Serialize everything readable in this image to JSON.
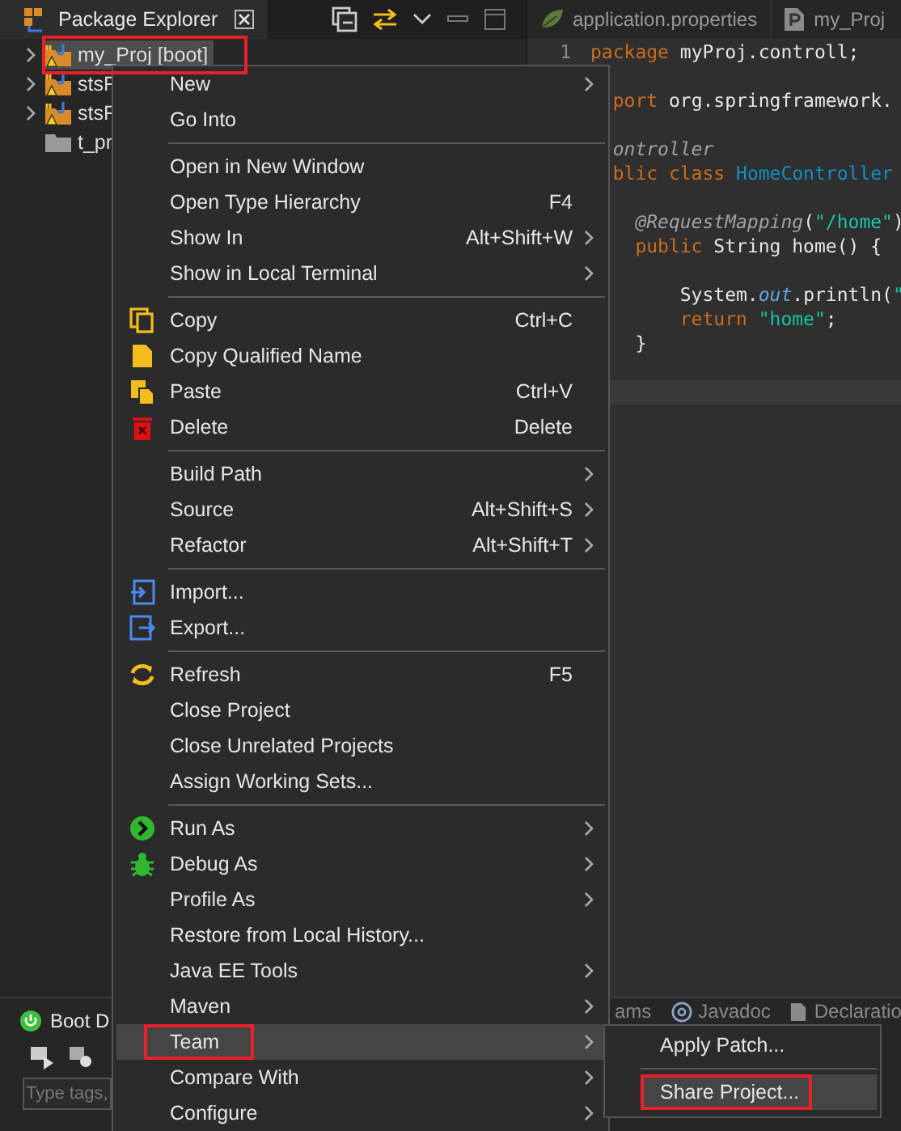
{
  "explorer": {
    "title": "Package Explorer",
    "tree": [
      {
        "label": "my_Proj [boot]",
        "kind": "project",
        "expandable": true,
        "selected": true,
        "annotated": true
      },
      {
        "label": "stsF",
        "kind": "project",
        "expandable": true,
        "selected": false,
        "annotated": false
      },
      {
        "label": "stsF",
        "kind": "project",
        "expandable": true,
        "selected": false,
        "annotated": false
      },
      {
        "label": "t_pr",
        "kind": "folder",
        "expandable": false,
        "selected": false,
        "annotated": false
      }
    ]
  },
  "editor": {
    "tabs": [
      {
        "label": "application.properties",
        "kind": "properties",
        "selected": false
      },
      {
        "label": "my_Proj",
        "kind": "java",
        "selected": true
      }
    ],
    "line_numbers": [
      "1"
    ],
    "lines": [
      {
        "kind": "code",
        "tokens": [
          {
            "kind": "keyword",
            "text": "package"
          },
          {
            "kind": "plain",
            "text": " myProj.controll;"
          }
        ]
      },
      {
        "kind": "blank"
      },
      {
        "kind": "code",
        "tokens": [
          {
            "kind": "keyword",
            "text": "  port"
          },
          {
            "kind": "plain",
            "text": " org.springframework."
          }
        ]
      },
      {
        "kind": "blank"
      },
      {
        "kind": "code",
        "tokens": [
          {
            "kind": "annotation",
            "text": "  ontroller"
          }
        ]
      },
      {
        "kind": "code",
        "tokens": [
          {
            "kind": "keyword",
            "text": "  blic class "
          },
          {
            "kind": "type",
            "text": "HomeController"
          }
        ]
      },
      {
        "kind": "blank"
      },
      {
        "kind": "code",
        "tokens": [
          {
            "kind": "annotation",
            "text": "    @RequestMapping"
          },
          {
            "kind": "plain",
            "text": "("
          },
          {
            "kind": "string",
            "text": "\"/home\""
          },
          {
            "kind": "plain",
            "text": ")"
          }
        ]
      },
      {
        "kind": "code",
        "tokens": [
          {
            "kind": "keyword",
            "text": "    public"
          },
          {
            "kind": "plain",
            "text": " String home() {"
          }
        ]
      },
      {
        "kind": "blank"
      },
      {
        "kind": "code",
        "tokens": [
          {
            "kind": "plain",
            "text": "        System."
          },
          {
            "kind": "field",
            "text": "out"
          },
          {
            "kind": "plain",
            "text": ".println("
          },
          {
            "kind": "string",
            "text": "\""
          }
        ]
      },
      {
        "kind": "code",
        "tokens": [
          {
            "kind": "keyword",
            "text": "        return "
          },
          {
            "kind": "string",
            "text": "\"home\""
          },
          {
            "kind": "plain",
            "text": ";"
          }
        ]
      },
      {
        "kind": "code",
        "tokens": [
          {
            "kind": "plain",
            "text": "    }"
          }
        ]
      },
      {
        "kind": "blank"
      },
      {
        "kind": "current"
      }
    ]
  },
  "boot_panel": {
    "title": "Boot D",
    "filter": {
      "placeholder": "Type tags,"
    }
  },
  "bottom_tabs": [
    {
      "label": "ams",
      "kind": "plain"
    },
    {
      "label": "Javadoc",
      "kind": "javadoc"
    },
    {
      "label": "Declaratio",
      "kind": "declaration"
    }
  ],
  "context_menu": {
    "items": [
      {
        "kind": "item",
        "label": "New",
        "has_submenu": true,
        "selected": false,
        "annotated": false
      },
      {
        "kind": "item",
        "label": "Go Into",
        "has_submenu": false,
        "selected": false,
        "annotated": false
      },
      {
        "kind": "separator"
      },
      {
        "kind": "item",
        "label": "Open in New Window",
        "has_submenu": false,
        "selected": false,
        "annotated": false
      },
      {
        "kind": "item",
        "label": "Open Type Hierarchy",
        "shortcut": "F4",
        "has_submenu": false,
        "selected": false,
        "annotated": false
      },
      {
        "kind": "item",
        "label": "Show In",
        "shortcut": "Alt+Shift+W",
        "has_submenu": true,
        "selected": false,
        "annotated": false
      },
      {
        "kind": "item",
        "label": "Show in Local Terminal",
        "has_submenu": true,
        "selected": false,
        "annotated": false
      },
      {
        "kind": "separator"
      },
      {
        "kind": "copy",
        "label": "Copy",
        "shortcut": "Ctrl+C",
        "has_submenu": false,
        "selected": false,
        "annotated": false
      },
      {
        "kind": "document",
        "label": "Copy Qualified Name",
        "has_submenu": false,
        "selected": false,
        "annotated": false
      },
      {
        "kind": "paste",
        "label": "Paste",
        "shortcut": "Ctrl+V",
        "has_submenu": false,
        "selected": false,
        "annotated": false
      },
      {
        "kind": "delete",
        "label": "Delete",
        "shortcut": "Delete",
        "has_submenu": false,
        "selected": false,
        "annotated": false
      },
      {
        "kind": "separator"
      },
      {
        "kind": "item",
        "label": "Build Path",
        "has_submenu": true,
        "selected": false,
        "annotated": false
      },
      {
        "kind": "item",
        "label": "Source",
        "shortcut": "Alt+Shift+S",
        "has_submenu": true,
        "selected": false,
        "annotated": false
      },
      {
        "kind": "item",
        "label": "Refactor",
        "shortcut": "Alt+Shift+T",
        "has_submenu": true,
        "selected": false,
        "annotated": false
      },
      {
        "kind": "separator"
      },
      {
        "kind": "import",
        "label": "Import...",
        "has_submenu": false,
        "selected": false,
        "annotated": false
      },
      {
        "kind": "export",
        "label": "Export...",
        "has_submenu": false,
        "selected": false,
        "annotated": false
      },
      {
        "kind": "separator"
      },
      {
        "kind": "refresh",
        "label": "Refresh",
        "shortcut": "F5",
        "has_submenu": false,
        "selected": false,
        "annotated": false
      },
      {
        "kind": "item",
        "label": "Close Project",
        "has_submenu": false,
        "selected": false,
        "annotated": false
      },
      {
        "kind": "item",
        "label": "Close Unrelated Projects",
        "has_submenu": false,
        "selected": false,
        "annotated": false
      },
      {
        "kind": "item",
        "label": "Assign Working Sets...",
        "has_submenu": false,
        "selected": false,
        "annotated": false
      },
      {
        "kind": "separator"
      },
      {
        "kind": "run",
        "label": "Run As",
        "has_submenu": true,
        "selected": false,
        "annotated": false
      },
      {
        "kind": "debug",
        "label": "Debug As",
        "has_submenu": true,
        "selected": false,
        "annotated": false
      },
      {
        "kind": "item",
        "label": "Profile As",
        "has_submenu": true,
        "selected": false,
        "annotated": false
      },
      {
        "kind": "item",
        "label": "Restore from Local History...",
        "has_submenu": false,
        "selected": false,
        "annotated": false
      },
      {
        "kind": "item",
        "label": "Java EE Tools",
        "has_submenu": true,
        "selected": false,
        "annotated": false
      },
      {
        "kind": "item",
        "label": "Maven",
        "has_submenu": true,
        "selected": false,
        "annotated": false
      },
      {
        "kind": "item",
        "label": "Team",
        "has_submenu": true,
        "selected": true,
        "annotated": true
      },
      {
        "kind": "item",
        "label": "Compare With",
        "has_submenu": true,
        "selected": false,
        "annotated": false
      },
      {
        "kind": "item",
        "label": "Configure",
        "has_submenu": true,
        "selected": false,
        "annotated": false
      }
    ]
  },
  "submenu": {
    "items": [
      {
        "kind": "item",
        "label": "Apply Patch...",
        "selected": false,
        "annotated": false
      },
      {
        "kind": "separator"
      },
      {
        "kind": "item",
        "label": "Share Project...",
        "selected": true,
        "annotated": true
      }
    ]
  }
}
